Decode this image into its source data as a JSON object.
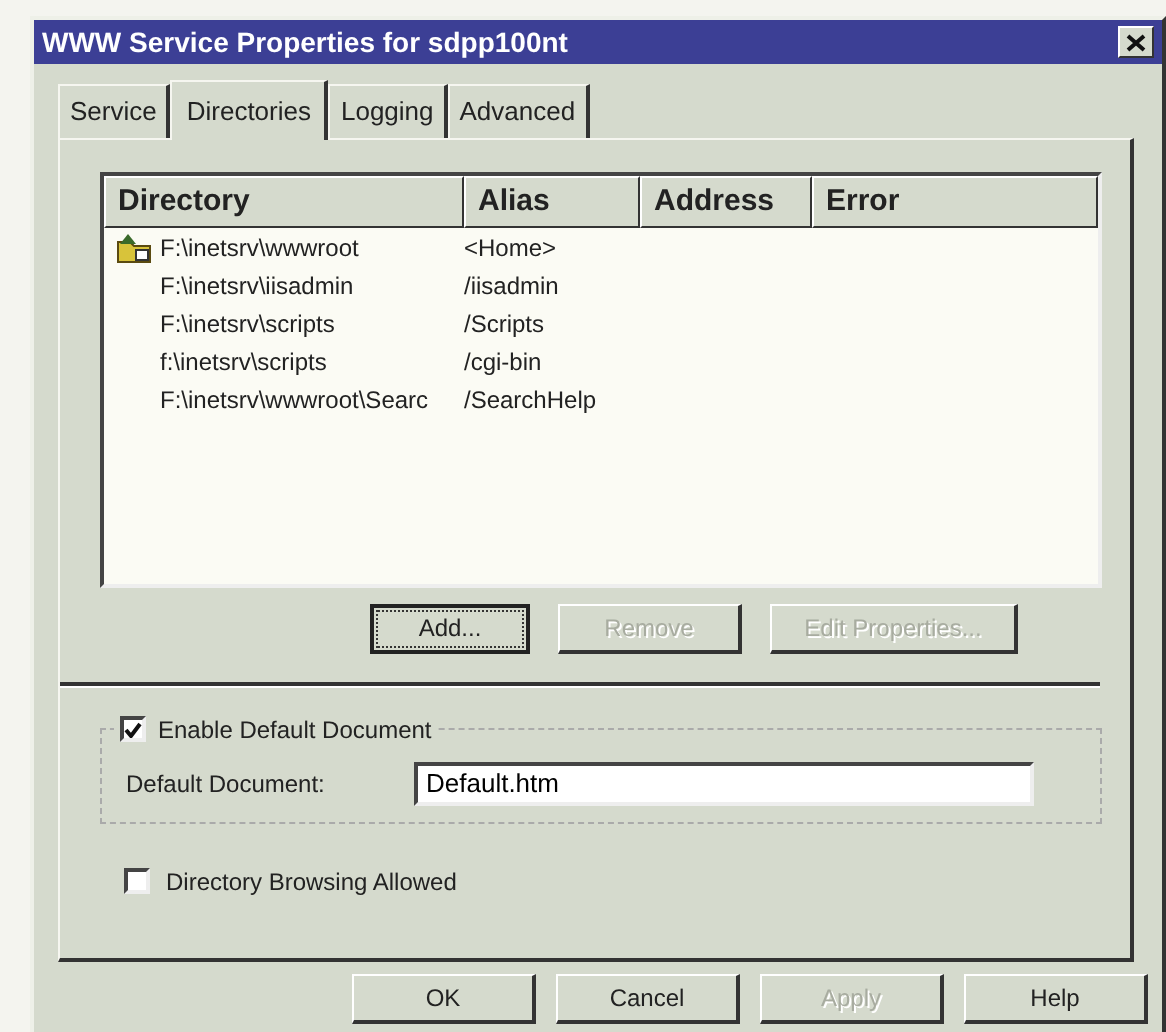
{
  "window": {
    "title": "WWW Service Properties for sdpp100nt"
  },
  "tabs": [
    {
      "label": "Service",
      "selected": false
    },
    {
      "label": "Directories",
      "selected": true
    },
    {
      "label": "Logging",
      "selected": false
    },
    {
      "label": "Advanced",
      "selected": false
    }
  ],
  "list": {
    "columns": [
      "Directory",
      "Alias",
      "Address",
      "Error"
    ],
    "rows": [
      {
        "kind": "home",
        "directory": "F:\\inetsrv\\wwwroot",
        "alias": "<Home>"
      },
      {
        "kind": "plain",
        "directory": "F:\\inetsrv\\iisadmin",
        "alias": "/iisadmin"
      },
      {
        "kind": "plain",
        "directory": "F:\\inetsrv\\scripts",
        "alias": "/Scripts"
      },
      {
        "kind": "plain",
        "directory": "f:\\inetsrv\\scripts",
        "alias": "/cgi-bin"
      },
      {
        "kind": "plain",
        "directory": "F:\\inetsrv\\wwwroot\\Searc",
        "alias": "/SearchHelp"
      }
    ]
  },
  "list_buttons": [
    {
      "label": "Add...",
      "disabled": false,
      "focused": true
    },
    {
      "label": "Remove",
      "disabled": true,
      "focused": false
    },
    {
      "label": "Edit Properties...",
      "disabled": true,
      "focused": false
    }
  ],
  "default_document": {
    "label": "Enable Default Document",
    "checked": true,
    "field_label": "Default Document:",
    "value": "Default.htm"
  },
  "directory_browsing": {
    "label": "Directory Browsing Allowed",
    "checked": false
  },
  "buttons": [
    {
      "label": "OK",
      "disabled": false
    },
    {
      "label": "Cancel",
      "disabled": false
    },
    {
      "label": "Apply",
      "disabled": true
    },
    {
      "label": "Help",
      "disabled": false
    }
  ]
}
